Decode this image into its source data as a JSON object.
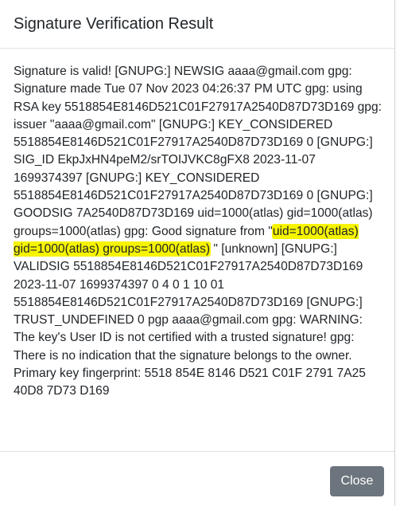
{
  "dialog": {
    "title": "Signature Verification Result",
    "message": {
      "before_highlight": "Signature is valid! [GNUPG:] NEWSIG aaaa@gmail.com gpg: Signature made Tue 07 Nov 2023 04:26:37 PM UTC gpg: using RSA key 5518854E8146D521C01F27917A2540D87D73D169 gpg: issuer \"aaaa@gmail.com\" [GNUPG:] KEY_CONSIDERED 5518854E8146D521C01F27917A2540D87D73D169 0 [GNUPG:] SIG_ID EkpJxHN4peM2/srTOIJVKC8gFX8 2023-11-07 1699374397 [GNUPG:] KEY_CONSIDERED 5518854E8146D521C01F27917A2540D87D73D169 0 [GNUPG:] GOODSIG 7A2540D87D73D169 uid=1000(atlas) gid=1000(atlas) groups=1000(atlas) gpg: Good signature from \"",
      "highlighted": "uid=1000(atlas) gid=1000(atlas) groups=1000(atlas)",
      "after_highlight": " \" [unknown] [GNUPG:] VALIDSIG 5518854E8146D521C01F27917A2540D87D73D169 2023-11-07 1699374397 0 4 0 1 10 01 5518854E8146D521C01F27917A2540D87D73D169 [GNUPG:] TRUST_UNDEFINED 0 pgp aaaa@gmail.com gpg: WARNING: The key's User ID is not certified with a trusted signature! gpg: There is no indication that the signature belongs to the owner. Primary key fingerprint: 5518 854E 8146 D521 C01F 2791 7A25 40D8 7D73 D169"
    },
    "close_label": "Close"
  },
  "colors": {
    "highlight": "#f6f400",
    "button": "#6c757d",
    "text": "#212529",
    "divider": "#dee2e6"
  }
}
